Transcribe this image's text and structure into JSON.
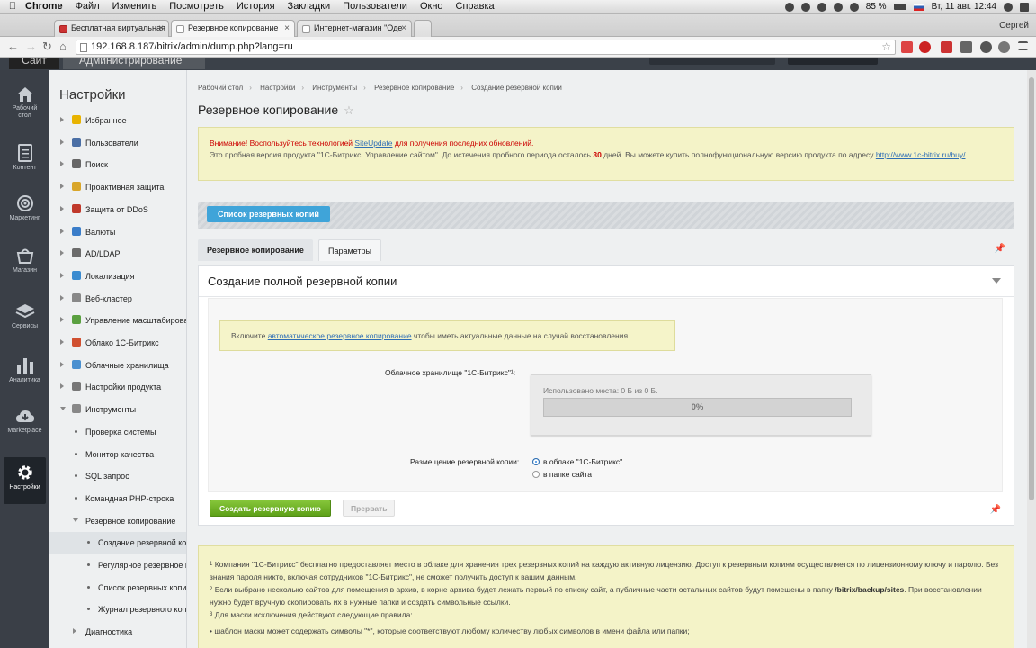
{
  "mac_menu": {
    "app": "Chrome",
    "items": [
      "Файл",
      "Изменить",
      "Посмотреть",
      "История",
      "Закладки",
      "Пользователи",
      "Окно",
      "Справка"
    ],
    "battery": "85 %",
    "clock": "Вт, 11 авг.  12:44"
  },
  "browser": {
    "tabs": [
      "Бесплатная виртуальная",
      "Резервное копирование",
      "Интернет-магазин \"Оде"
    ],
    "profile": "Сергей",
    "url": "192.168.8.187/bitrix/admin/dump.php?lang=ru"
  },
  "admin_header": {
    "site": "Сайт",
    "admin": "Администрирование"
  },
  "left_nav": [
    {
      "label1": "Рабочий",
      "label2": "стол",
      "icon": "home-icon"
    },
    {
      "label1": "Контент",
      "label2": "",
      "icon": "document-icon"
    },
    {
      "label1": "Маркетинг",
      "label2": "",
      "icon": "target-icon"
    },
    {
      "label1": "Магазин",
      "label2": "",
      "icon": "cart-icon"
    },
    {
      "label1": "Сервисы",
      "label2": "",
      "icon": "layers-icon"
    },
    {
      "label1": "Аналитика",
      "label2": "",
      "icon": "bars-icon"
    },
    {
      "label1": "Marketplace",
      "label2": "",
      "icon": "cloud-download-icon"
    },
    {
      "label1": "Настройки",
      "label2": "",
      "icon": "gear-icon"
    }
  ],
  "submenu": {
    "title": "Настройки",
    "items": [
      {
        "label": "Избранное",
        "color": "#e8b300"
      },
      {
        "label": "Пользователи",
        "color": "#4b6fa5"
      },
      {
        "label": "Поиск",
        "color": "#666666"
      },
      {
        "label": "Проактивная защита",
        "color": "#d9a62a"
      },
      {
        "label": "Защита от DDoS",
        "color": "#c0392b"
      },
      {
        "label": "Валюты",
        "color": "#3a7dc9"
      },
      {
        "label": "AD/LDAP",
        "color": "#6b6b6b"
      },
      {
        "label": "Локализация",
        "color": "#3a8bd0"
      },
      {
        "label": "Веб-кластер",
        "color": "#888888"
      },
      {
        "label": "Управление масштабированием",
        "color": "#5aa040"
      },
      {
        "label": "Облако 1С-Битрикс",
        "color": "#d05030"
      },
      {
        "label": "Облачные хранилища",
        "color": "#4a90d0"
      },
      {
        "label": "Настройки продукта",
        "color": "#777777"
      },
      {
        "label": "Инструменты",
        "color": "#888888"
      }
    ],
    "tools_children": [
      "Проверка системы",
      "Монитор качества",
      "SQL запрос",
      "Командная PHP-строка",
      "Резервное копирование"
    ],
    "backup_children": [
      "Создание резервной копии",
      "Регулярное резервное копирование",
      "Список резервных копий",
      "Журнал резервного копирования"
    ],
    "last": "Диагностика"
  },
  "breadcrumbs": [
    "Рабочий стол",
    "Настройки",
    "Инструменты",
    "Резервное копирование",
    "Создание резервной копии"
  ],
  "page_title": "Резервное копирование",
  "notice": {
    "warn_before": "Внимание! Воспользуйтесь технологией ",
    "warn_link": "SiteUpdate",
    "warn_after": " для получения последних обновлений.",
    "trial_before": "Это пробная версия продукта \"1С-Битрикс: Управление сайтом\". До истечения пробного периода осталось ",
    "trial_days": "30",
    "trial_after": " дней. Вы можете купить полнофункциональную версию продукта по адресу ",
    "trial_link": "http://www.1c-bitrix.ru/buy/"
  },
  "list_button": "Список резервных копий",
  "tabs": [
    "Резервное копирование",
    "Параметры"
  ],
  "panel": {
    "title": "Создание полной резервной копии",
    "auto_before": "Включите ",
    "auto_link": "автоматическое резервное копирование",
    "auto_after": " чтобы иметь актуальные данные на случай восстановления.",
    "cloud_label": "Облачное хранилище \"1С-Битрикс\"¹:",
    "usage_text": "Использовано места: 0 Б из 0 Б.",
    "usage_percent": "0%",
    "usage_fraction": 0,
    "placement_label": "Размещение резервной копии:",
    "option_cloud": "в облаке \"1С-Битрикс\"",
    "option_site": "в папке сайта",
    "create_button": "Создать резервную копию",
    "stop_button": "Прервать"
  },
  "footnotes": {
    "n1": "1",
    "f1": "Компания \"1С-Битрикс\" бесплатно предоставляет место в облаке для хранения трех резервных копий на каждую активную лицензию. Доступ к резервным копиям осуществляется по лицензионному ключу и паролю. Без знания пароля никто, включая сотрудников \"1С-Битрикс\", не сможет получить доступ к вашим данным.",
    "n2": "2",
    "f2_before": "Если выбрано несколько сайтов для помещения в архив, в корне архива будет лежать первый по списку сайт, а публичные части остальных сайтов будут помещены в папку ",
    "f2_path": "/bitrix/backup/sites",
    "f2_after": ". При восстановлении нужно будет вручную скопировать их в нужные папки и создать символьные ссылки.",
    "n3": "3",
    "f3": "Для маски исключения действуют следующие правила:",
    "f3_rule": "шаблон маски может содержать символы \"*\", которые соответствуют любому количеству любых символов в имени файла или папки;"
  }
}
